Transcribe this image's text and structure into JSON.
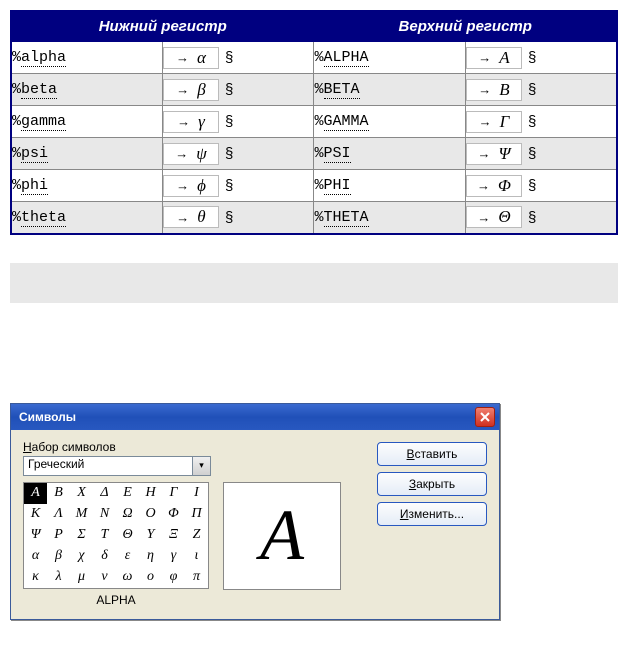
{
  "table": {
    "headers": {
      "lower": "Нижний регистр",
      "upper": "Верхний регистр"
    },
    "arrow": "→",
    "section": "§",
    "rows": [
      {
        "lower_cmd": "alpha",
        "lower_glyph": "α",
        "upper_cmd": "ALPHA",
        "upper_glyph": "A"
      },
      {
        "lower_cmd": "beta",
        "lower_glyph": "β",
        "upper_cmd": "BETA",
        "upper_glyph": "B"
      },
      {
        "lower_cmd": "gamma",
        "lower_glyph": "γ",
        "upper_cmd": "GAMMA",
        "upper_glyph": "Γ"
      },
      {
        "lower_cmd": "psi",
        "lower_glyph": "ψ",
        "upper_cmd": "PSI",
        "upper_glyph": "Ψ"
      },
      {
        "lower_cmd": "phi",
        "lower_glyph": "ϕ",
        "upper_cmd": "PHI",
        "upper_glyph": "Φ"
      },
      {
        "lower_cmd": "theta",
        "lower_glyph": "θ",
        "upper_cmd": "THETA",
        "upper_glyph": "Θ"
      }
    ],
    "percent": "%"
  },
  "dialog": {
    "title": "Символы",
    "set_label_pre": "Н",
    "set_label_rest": "абор символов",
    "set_value": "Греческий",
    "buttons": {
      "insert_u": "В",
      "insert_rest": "ставить",
      "close_u": "З",
      "close_rest": "акрыть",
      "edit_u": "И",
      "edit_rest": "зменить..."
    },
    "selected_name": "ALPHA",
    "preview_glyph": "A",
    "grid": [
      [
        "A",
        "B",
        "X",
        "Δ",
        "E",
        "H",
        "Γ",
        "I"
      ],
      [
        "K",
        "Λ",
        "M",
        "N",
        "Ω",
        "O",
        "Φ",
        "Π"
      ],
      [
        "Ψ",
        "P",
        "Σ",
        "T",
        "Θ",
        "Y",
        "Ξ",
        "Z"
      ],
      [
        "α",
        "β",
        "χ",
        "δ",
        "ε",
        "η",
        "γ",
        "ι"
      ],
      [
        "κ",
        "λ",
        "μ",
        "ν",
        "ω",
        "o",
        "φ",
        "π"
      ]
    ],
    "selected_index": [
      0,
      0
    ]
  }
}
